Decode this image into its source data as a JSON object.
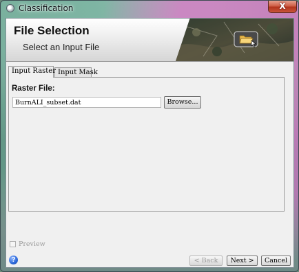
{
  "window": {
    "title": "Classification",
    "close_label": "X"
  },
  "header": {
    "title": "File Selection",
    "subtitle": "Select an Input File"
  },
  "tabs": [
    {
      "label": "Input Raster",
      "active": true
    },
    {
      "label": "Input Mask",
      "active": false
    }
  ],
  "raster": {
    "label": "Raster File:",
    "value": "BurnALI_subset.dat",
    "browse_label": "Browse..."
  },
  "footer": {
    "preview_label": "Preview",
    "preview_checked": false,
    "help_label": "?",
    "back_label": "< Back",
    "next_label": "Next >",
    "cancel_label": "Cancel"
  },
  "colors": {
    "close_button": "#c8553a",
    "help_icon": "#2a66d8"
  },
  "icons": {
    "app": "app-icon",
    "header": "folder-open-icon",
    "help": "help-icon"
  }
}
